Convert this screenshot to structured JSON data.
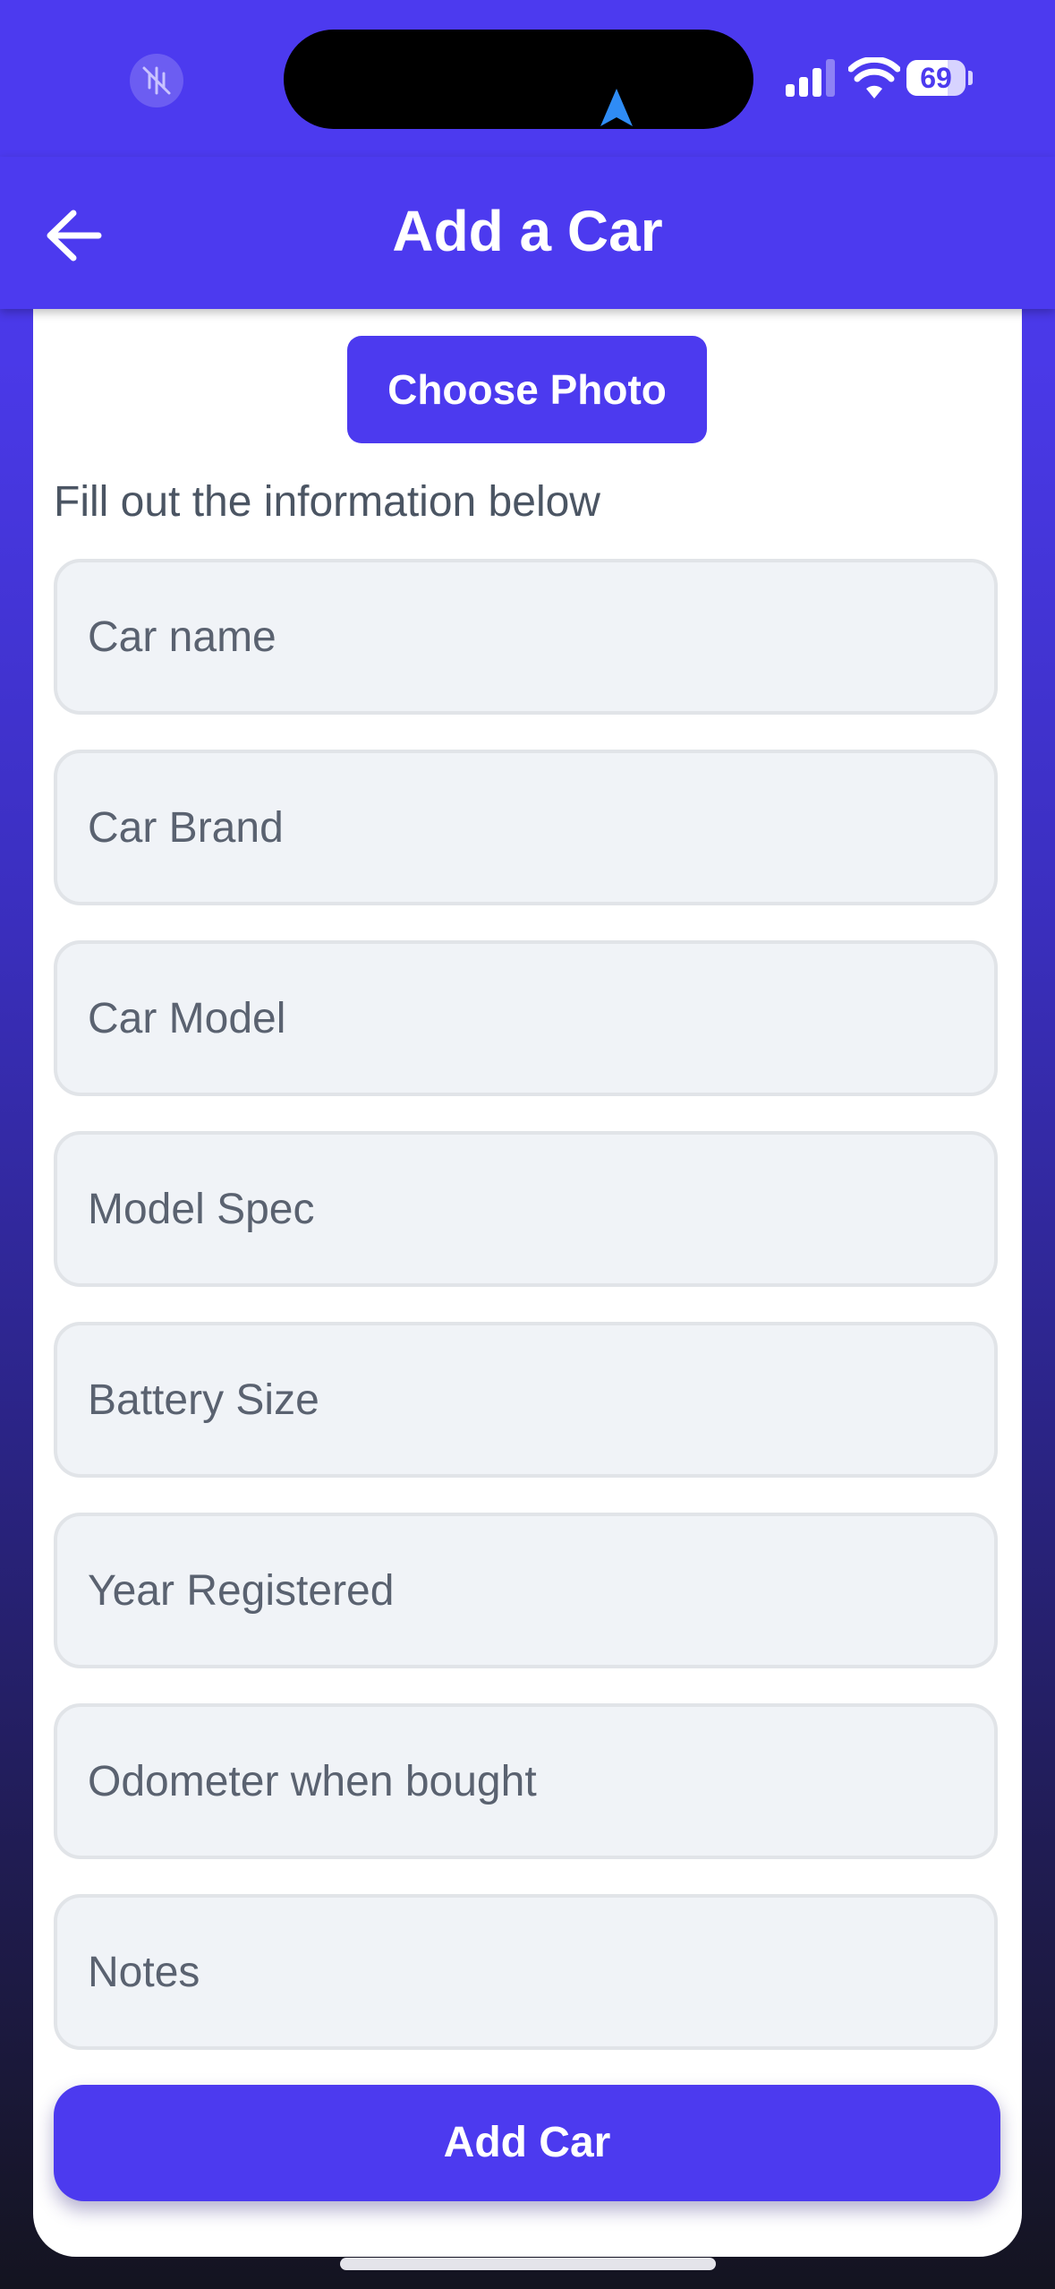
{
  "status_bar": {
    "battery_level": "69",
    "battery_fraction": 0.69,
    "accent": "#4c3aef"
  },
  "header": {
    "title": "Add a Car",
    "back_icon": "arrow-left-icon"
  },
  "photo_button": {
    "label": "Choose Photo"
  },
  "form": {
    "instructions": "Fill out the information below",
    "fields": [
      {
        "placeholder": "Car name",
        "value": ""
      },
      {
        "placeholder": "Car Brand",
        "value": ""
      },
      {
        "placeholder": "Car Model",
        "value": ""
      },
      {
        "placeholder": "Model Spec",
        "value": ""
      },
      {
        "placeholder": "Battery Size",
        "value": ""
      },
      {
        "placeholder": "Year Registered",
        "value": ""
      },
      {
        "placeholder": "Odometer when bought",
        "value": ""
      },
      {
        "placeholder": "Notes",
        "value": ""
      }
    ],
    "submit_label": "Add Car"
  }
}
